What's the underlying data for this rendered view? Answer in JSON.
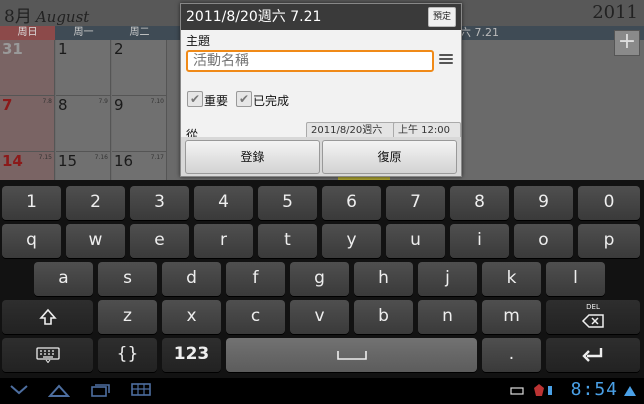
{
  "calendar": {
    "month": "8月",
    "month_en": "August",
    "year": "2011",
    "weekdays": [
      "周日",
      "周一",
      "周二"
    ],
    "weekrow_tail": "六 7.21",
    "add_label": "+",
    "rows": [
      [
        {
          "day": "31",
          "lunar": "",
          "faded": true
        },
        {
          "day": "1",
          "lunar": "",
          "faded": false
        },
        {
          "day": "2",
          "lunar": "",
          "faded": false
        }
      ],
      [
        {
          "day": "7",
          "lunar": "7.8",
          "faded": false
        },
        {
          "day": "8",
          "lunar": "7.9",
          "faded": false
        },
        {
          "day": "9",
          "lunar": "7.10",
          "faded": false
        }
      ],
      [
        {
          "day": "14",
          "lunar": "7.15",
          "faded": false
        },
        {
          "day": "15",
          "lunar": "7.16",
          "faded": false
        },
        {
          "day": "16",
          "lunar": "7.17",
          "faded": false
        }
      ]
    ]
  },
  "dialog": {
    "title": "2011/8/20週六 7.21",
    "preset": "預定",
    "subject_label": "主題",
    "subject_placeholder": "活動名稱",
    "important_label": "重要",
    "done_label": "已完成",
    "from_label": "從",
    "date_value": "2011/8/20週六",
    "time_value": "上午 12:00",
    "save_label": "登錄",
    "revert_label": "復原"
  },
  "keyboard": {
    "row1": [
      "1",
      "2",
      "3",
      "4",
      "5",
      "6",
      "7",
      "8",
      "9",
      "0"
    ],
    "row2": [
      "q",
      "w",
      "e",
      "r",
      "t",
      "y",
      "u",
      "i",
      "o",
      "p"
    ],
    "row3": [
      "a",
      "s",
      "d",
      "f",
      "g",
      "h",
      "j",
      "k",
      "l"
    ],
    "row4": [
      "z",
      "x",
      "c",
      "v",
      "b",
      "n",
      "m"
    ],
    "delete_label": "DEL",
    "braces_label": "{}",
    "numeric_label": "123",
    "period_label": "."
  },
  "status": {
    "clock": "8:54"
  }
}
